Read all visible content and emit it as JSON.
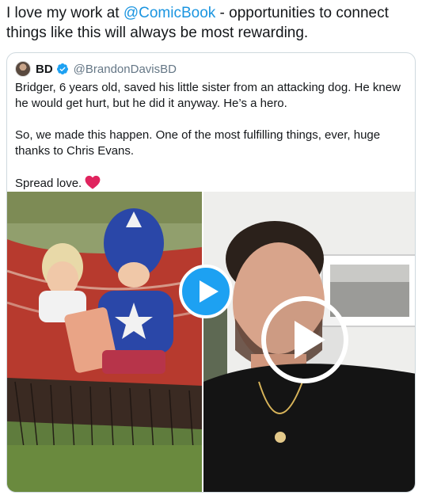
{
  "tweet": {
    "text_before": "I love my work at ",
    "mention": "@ComicBook",
    "text_after": " - opportunities to connect things like this will always be most rewarding."
  },
  "quoted_tweet": {
    "display_name": "BD",
    "handle": "@BrandonDavisBD",
    "paragraph_1": "Bridger, 6 years old, saved his little sister from an attacking dog. He knew he would get hurt, but he did it anyway. He’s a hero.",
    "paragraph_2": "So, we made this happen. One of the most fulfilling things, ever, huge thanks to Chris Evans.",
    "paragraph_3": "Spread love."
  },
  "colors": {
    "link": "#1b95e0",
    "verified": "#1da1f2",
    "heart": "#e0245e",
    "play_blue": "#1da1f2"
  },
  "icons": [
    "verified-badge-icon",
    "heart-icon",
    "play-icon"
  ]
}
